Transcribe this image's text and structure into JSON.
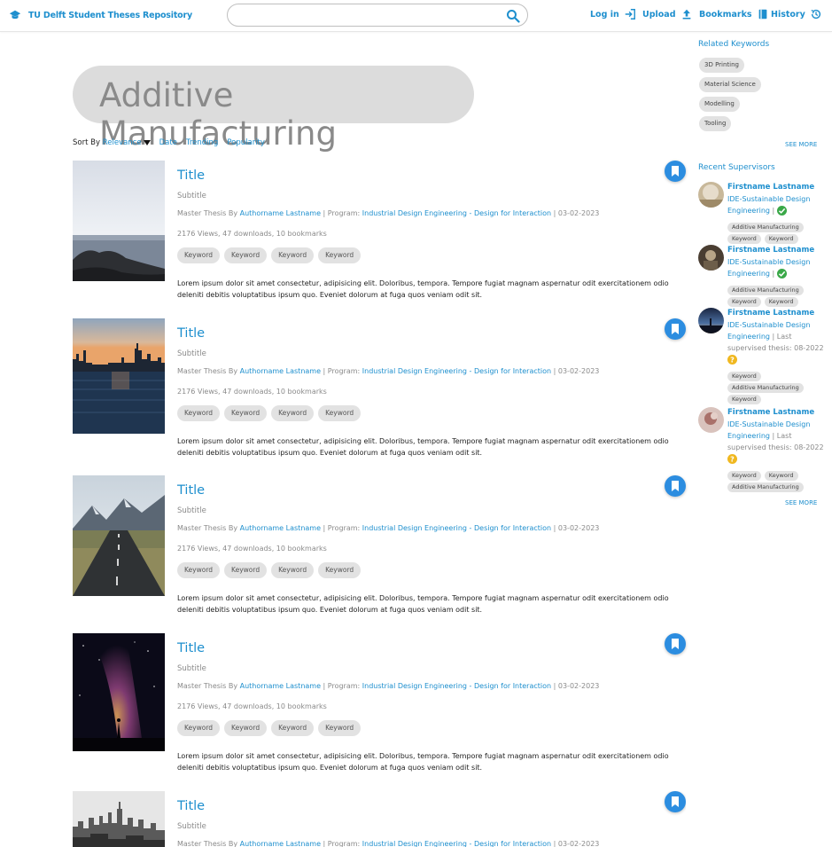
{
  "header": {
    "brand": "TU Delft Student Theses Repository",
    "search_value": "",
    "nav": {
      "login": "Log in",
      "upload": "Upload",
      "bookmarks": "Bookmarks",
      "history": "History"
    }
  },
  "main": {
    "keyword": "Additive Manufacturing",
    "sort": {
      "label": "Sort By",
      "selected": "Relevance",
      "options": [
        "Date",
        "Trending",
        "Popularity"
      ]
    },
    "results": [
      {
        "title": "Title",
        "subtitle": "Subtitle",
        "meta_prefix": "Master Thesis By",
        "author": "Authorname Lastname",
        "program_label": "| Program:",
        "program": "Industrial Design Engineering - Design for Interaction",
        "date": "| 03-02-2023",
        "stats": "2176 Views, 47 downloads, 10 bookmarks",
        "keywords": [
          "Keyword",
          "Keyword",
          "Keyword",
          "Keyword"
        ],
        "description": "Lorem ipsum dolor sit amet consectetur, adipisicing elit. Doloribus, tempora. Tempore fugiat magnam aspernatur odit exercitationem odio deleniti debitis voluptatibus ipsum quo. Eveniet dolorum at fuga quos veniam odit sit.",
        "image": "rocky-coast"
      },
      {
        "title": "Title",
        "subtitle": "Subtitle",
        "meta_prefix": "Master Thesis By",
        "author": "Authorname Lastname",
        "program_label": "| Program:",
        "program": "Industrial Design Engineering - Design for Interaction",
        "date": "| 03-02-2023",
        "stats": "2176 Views, 47 downloads, 10 bookmarks",
        "keywords": [
          "Keyword",
          "Keyword",
          "Keyword",
          "Keyword"
        ],
        "description": "Lorem ipsum dolor sit amet consectetur, adipisicing elit. Doloribus, tempora. Tempore fugiat magnam aspernatur odit exercitationem odio deleniti debitis voluptatibus ipsum quo. Eveniet dolorum at fuga quos veniam odit sit.",
        "image": "city-skyline"
      },
      {
        "title": "Title",
        "subtitle": "Subtitle",
        "meta_prefix": "Master Thesis By",
        "author": "Authorname Lastname",
        "program_label": "| Program:",
        "program": "Industrial Design Engineering - Design for Interaction",
        "date": "| 03-02-2023",
        "stats": "2176 Views, 47 downloads, 10 bookmarks",
        "keywords": [
          "Keyword",
          "Keyword",
          "Keyword",
          "Keyword"
        ],
        "description": "Lorem ipsum dolor sit amet consectetur, adipisicing elit. Doloribus, tempora. Tempore fugiat magnam aspernatur odit exercitationem odio deleniti debitis voluptatibus ipsum quo. Eveniet dolorum at fuga quos veniam odit sit.",
        "image": "mountain-road"
      },
      {
        "title": "Title",
        "subtitle": "Subtitle",
        "meta_prefix": "Master Thesis By",
        "author": "Authorname Lastname",
        "program_label": "| Program:",
        "program": "Industrial Design Engineering - Design for Interaction",
        "date": "| 03-02-2023",
        "stats": "2176 Views, 47 downloads, 10 bookmarks",
        "keywords": [
          "Keyword",
          "Keyword",
          "Keyword",
          "Keyword"
        ],
        "description": "Lorem ipsum dolor sit amet consectetur, adipisicing elit. Doloribus, tempora. Tempore fugiat magnam aspernatur odit exercitationem odio deleniti debitis voluptatibus ipsum quo. Eveniet dolorum at fuga quos veniam odit sit.",
        "image": "milky-way"
      },
      {
        "title": "Title",
        "subtitle": "Subtitle",
        "meta_prefix": "Master Thesis By",
        "author": "Authorname Lastname",
        "program_label": "| Program:",
        "program": "Industrial Design Engineering - Design for Interaction",
        "date": "| 03-02-2023",
        "image": "city-bw"
      }
    ]
  },
  "sidebar": {
    "related_title": "Related Keywords",
    "related": [
      "3D Printing",
      "Material Science",
      "Modelling",
      "Tooling"
    ],
    "see_more": "SEE MORE",
    "supervisors_title": "Recent Supervisors",
    "supervisors": [
      {
        "name": "Firstname Lastname",
        "dept": "IDE-Sustainable Design Engineering",
        "sep": "|",
        "last": "",
        "status": "ok",
        "keywords": [
          "Additive Manufacturing",
          "Keyword",
          "Keyword"
        ]
      },
      {
        "name": "Firstname Lastname",
        "dept": "IDE-Sustainable Design Engineering",
        "sep": "|",
        "last": "",
        "status": "ok",
        "keywords": [
          "Additive Manufacturing",
          "Keyword",
          "Keyword"
        ]
      },
      {
        "name": "Firstname Lastname",
        "dept": "IDE-Sustainable Design Engineering",
        "sep": "|",
        "last": "Last supervised thesis: 08-2022",
        "status": "question",
        "keywords": [
          "Keyword",
          "Additive Manufacturing",
          "Keyword"
        ]
      },
      {
        "name": "Firstname Lastname",
        "dept": "IDE-Sustainable Design Engineering",
        "sep": "|",
        "last": "Last supervised thesis: 08-2022",
        "status": "question",
        "keywords": [
          "Keyword",
          "Keyword",
          "Additive Manufacturing"
        ]
      }
    ],
    "see_more_2": "SEE MORE"
  },
  "colors": {
    "accent": "#1e8fce",
    "button": "#2c8de0",
    "chip": "#e2e2e2",
    "ok": "#3aa848",
    "warn": "#f0b820"
  }
}
